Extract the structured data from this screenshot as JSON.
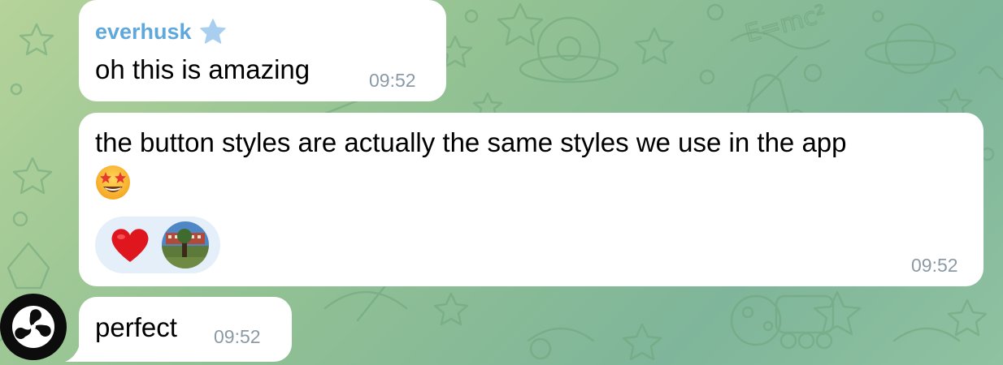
{
  "messages": [
    {
      "sender": "everhusk",
      "sender_badge": "star-icon",
      "text": "oh this is amazing",
      "time": "09:52"
    },
    {
      "text": "the button styles are actually the same styles we use in the app",
      "emoji": "star-struck-emoji",
      "reactions": [
        "heart-emoji",
        "reactor-avatar"
      ],
      "time": "09:52"
    },
    {
      "text": "perfect",
      "time": "09:52",
      "avatar": "yin-yang-avatar"
    }
  ],
  "colors": {
    "background": "#92c193",
    "bubble": "#ffffff",
    "sender_name": "#5fa8db",
    "timestamp": "#8a9aa6",
    "reaction_bg": "#e4eff9"
  }
}
